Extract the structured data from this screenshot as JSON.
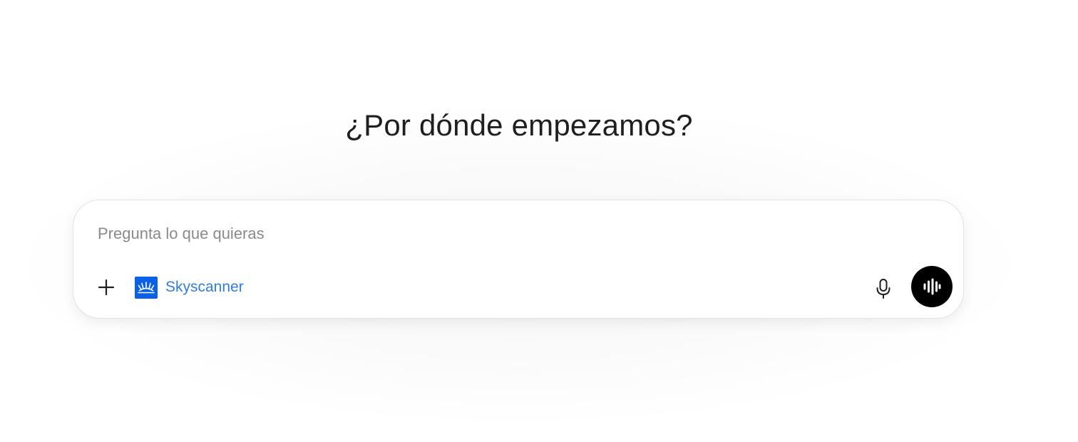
{
  "main": {
    "heading": "¿Por dónde empezamos?"
  },
  "composer": {
    "placeholder": "Pregunta lo que quieras",
    "value": "",
    "add_icon": "plus-icon",
    "tool": {
      "label": "Skyscanner",
      "icon": "skyscanner-logo-icon",
      "color": "#2f7de1",
      "logo_color": "#0a61e5"
    },
    "mic_icon": "microphone-icon",
    "voice_icon": "voice-waveform-icon",
    "voice_button_color": "#000000"
  }
}
